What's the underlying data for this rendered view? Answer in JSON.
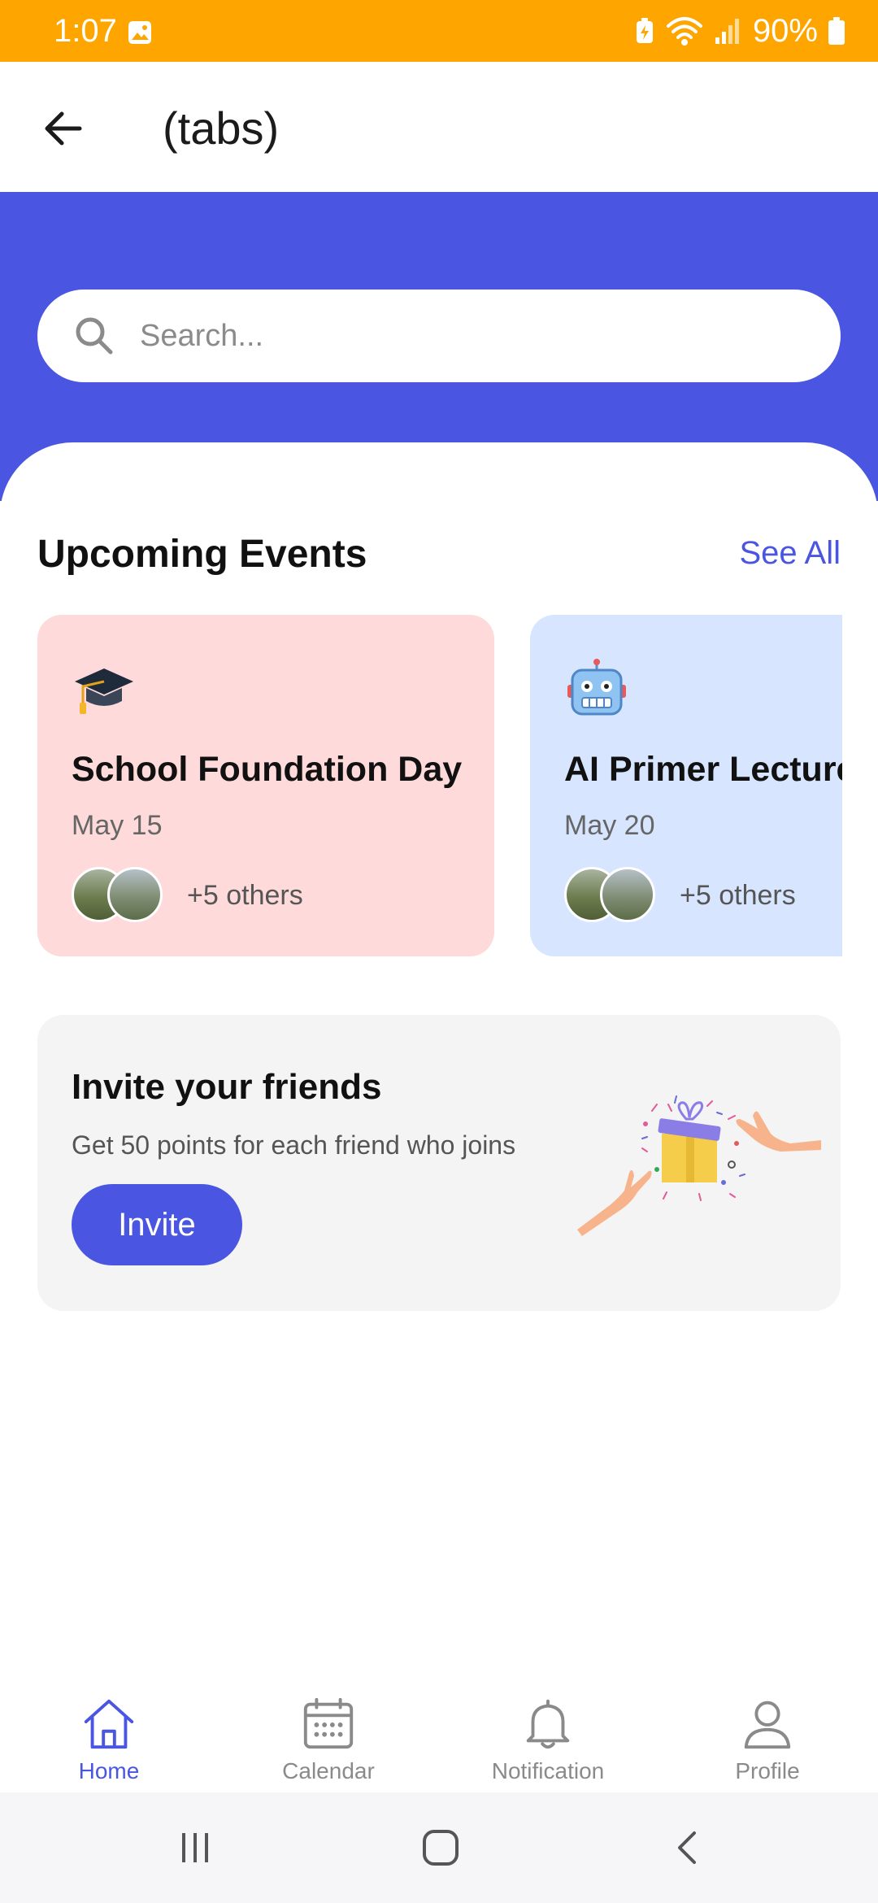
{
  "status_bar": {
    "time": "1:07",
    "battery": "90%"
  },
  "app_bar": {
    "title": "(tabs)"
  },
  "search": {
    "placeholder": "Search..."
  },
  "events": {
    "section_title": "Upcoming Events",
    "see_all_label": "See All",
    "items": [
      {
        "emoji": "graduation-cap-icon",
        "title": "School Foundation Day",
        "date": "May 15",
        "others": "+5 others",
        "color": "#FEDADA"
      },
      {
        "emoji": "robot-icon",
        "title": "AI Primer Lecture",
        "date": "May 20",
        "others": "+5 others",
        "color": "#D7E5FE"
      }
    ]
  },
  "invite": {
    "title": "Invite your friends",
    "subtitle": "Get 50 points for each friend who joins",
    "button_label": "Invite"
  },
  "bottom_nav": {
    "items": [
      {
        "label": "Home",
        "icon": "home-icon",
        "active": true
      },
      {
        "label": "Calendar",
        "icon": "calendar-icon",
        "active": false
      },
      {
        "label": "Notification",
        "icon": "bell-icon",
        "active": false
      },
      {
        "label": "Profile",
        "icon": "user-icon",
        "active": false
      }
    ]
  },
  "colors": {
    "status_bar": "#FFA500",
    "accent": "#4A56E2",
    "card_pink": "#FEDADA",
    "card_blue": "#D7E5FE",
    "invite_bg": "#F4F4F4"
  }
}
